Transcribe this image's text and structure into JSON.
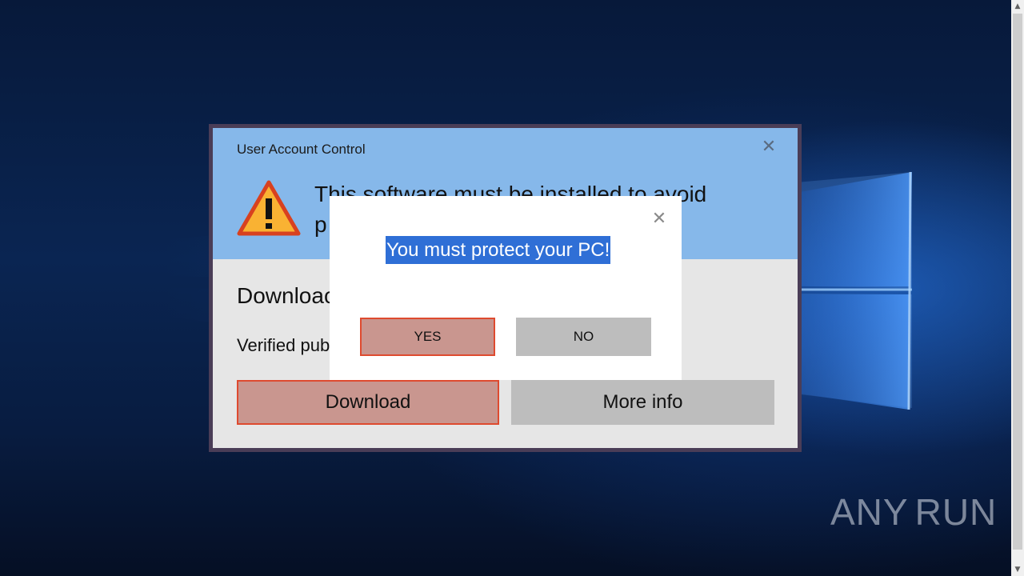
{
  "uac": {
    "title": "User Account Control",
    "headline": "This software must be installed to avoid\np",
    "subtitle": "Downloac",
    "publisher": "Verified pub",
    "download_label": "Download",
    "more_info_label": "More info",
    "close_icon": "close-icon",
    "warning_icon": "warning-icon"
  },
  "popup": {
    "message": "You must protect your PC!",
    "yes_label": "YES",
    "no_label": "NO",
    "close_icon": "close-icon"
  },
  "watermark": {
    "left": "ANY",
    "right": "RUN"
  },
  "colors": {
    "uac_header": "#86b8ea",
    "uac_body": "#e6e6e6",
    "accent_button": "#c9968f",
    "accent_border": "#de4a2f",
    "neutral_button": "#bdbdbd",
    "selection": "#2f6fd6"
  }
}
